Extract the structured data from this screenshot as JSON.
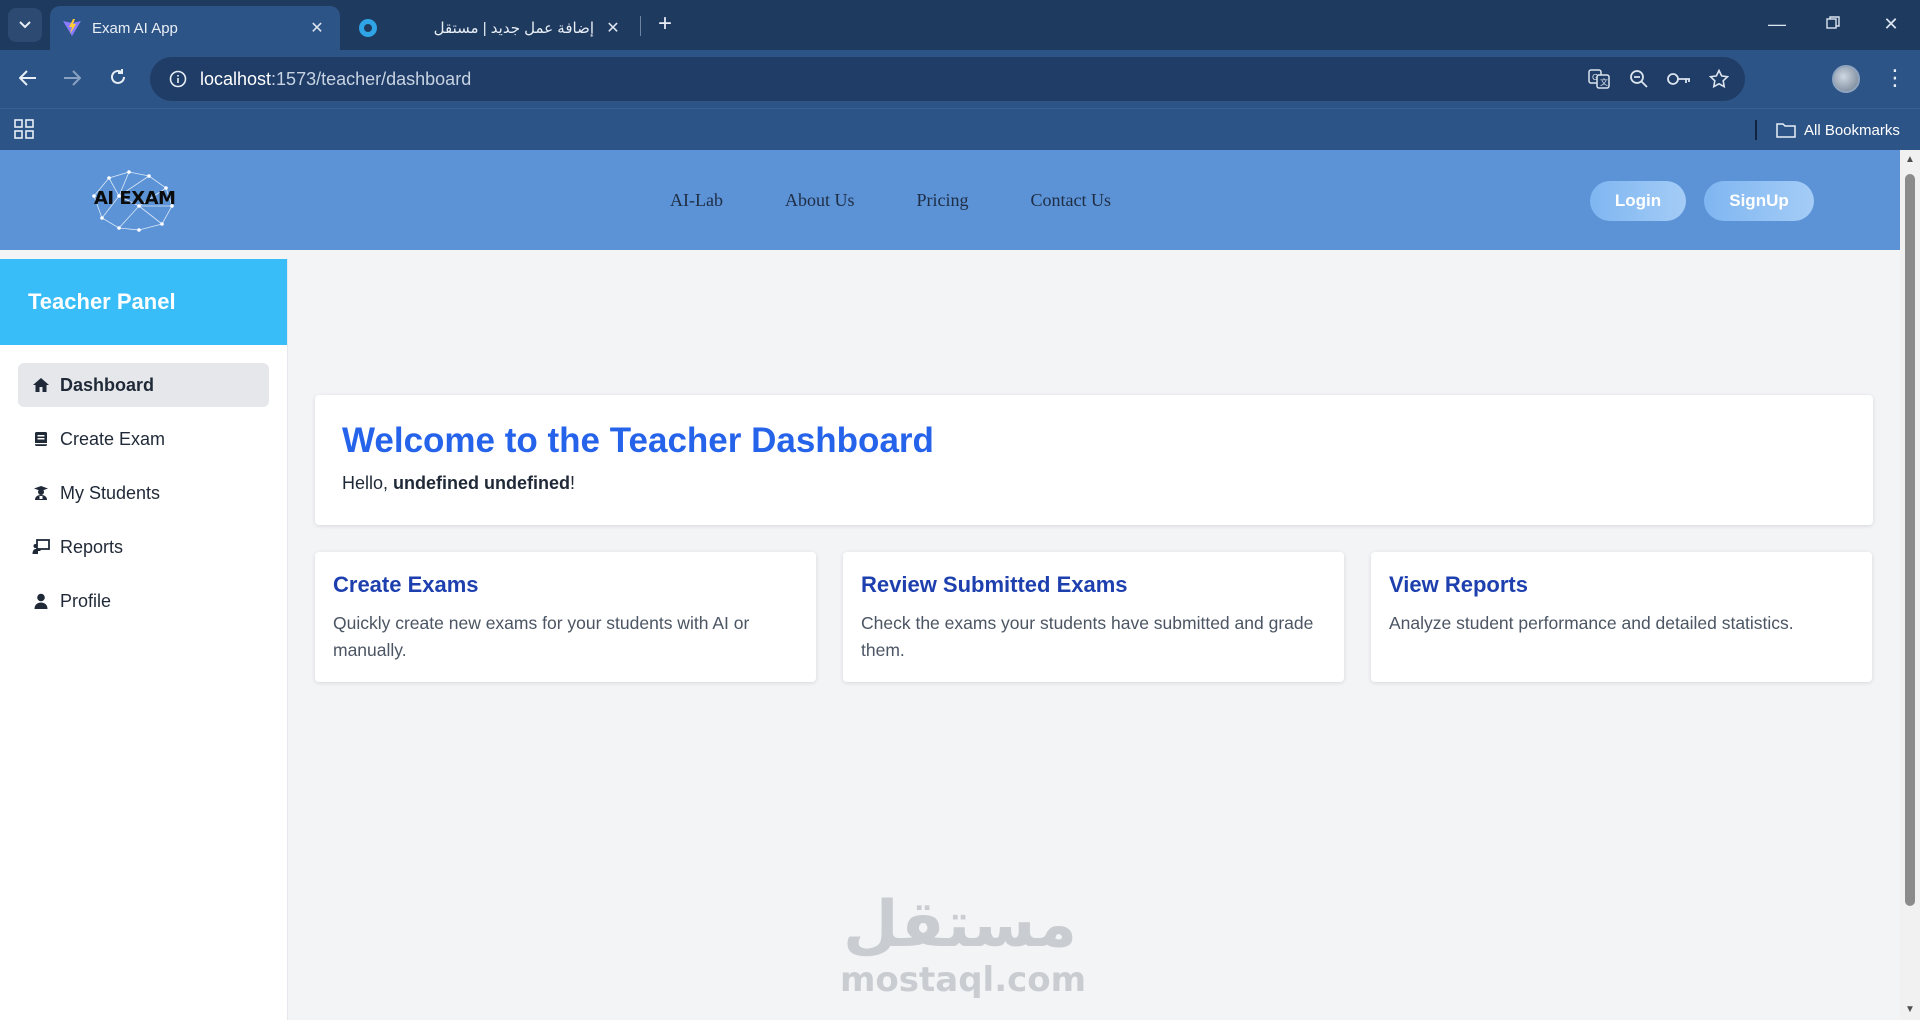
{
  "browser": {
    "tabs": [
      {
        "title": "Exam AI App",
        "active": true
      },
      {
        "title": "إضافة عمل جديد | مستقل",
        "active": false
      }
    ],
    "url_host": "localhost",
    "url_path": ":1573/teacher/dashboard",
    "bookmarks_label": "All Bookmarks"
  },
  "header": {
    "logo_text": "AI EXAM",
    "nav": [
      "AI-Lab",
      "About Us",
      "Pricing",
      "Contact Us"
    ],
    "login_label": "Login",
    "signup_label": "SignUp"
  },
  "sidebar": {
    "title": "Teacher Panel",
    "items": [
      {
        "label": "Dashboard",
        "icon": "home-icon",
        "active": true
      },
      {
        "label": "Create Exam",
        "icon": "book-icon",
        "active": false
      },
      {
        "label": "My Students",
        "icon": "student-icon",
        "active": false
      },
      {
        "label": "Reports",
        "icon": "chalkboard-icon",
        "active": false
      },
      {
        "label": "Profile",
        "icon": "user-icon",
        "active": false
      }
    ]
  },
  "main": {
    "welcome_title": "Welcome to the Teacher Dashboard",
    "greeting_prefix": "Hello, ",
    "greeting_name": "undefined undefined",
    "greeting_suffix": "!",
    "cards": [
      {
        "title": "Create Exams",
        "text": "Quickly create new exams for your students with AI or manually."
      },
      {
        "title": "Review Submitted Exams",
        "text": "Check the exams your students have submitted and grade them."
      },
      {
        "title": "View Reports",
        "text": "Analyze student performance and detailed statistics."
      }
    ]
  },
  "watermark": {
    "arabic": "مستقل",
    "latin": "mostaql.com"
  },
  "colors": {
    "header": "#5b93d6",
    "sidebar_head": "#38bdf8",
    "title_blue": "#2563eb",
    "card_title": "#1e40af"
  }
}
